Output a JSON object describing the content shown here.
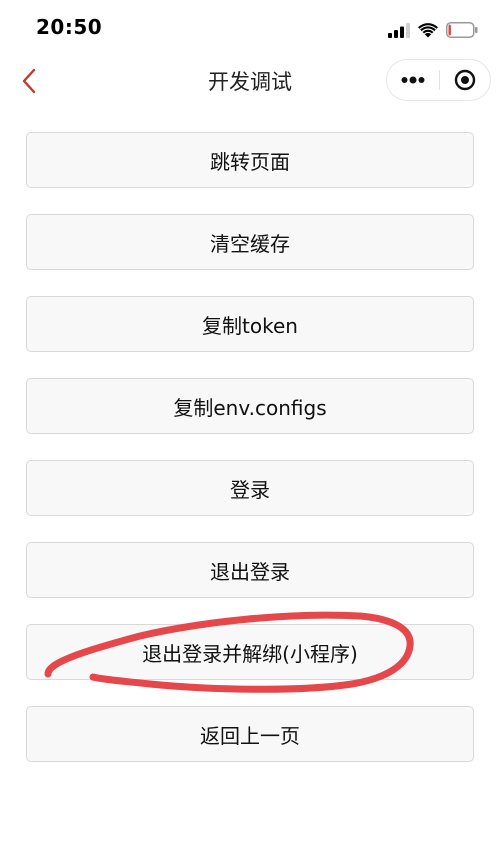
{
  "status_bar": {
    "time": "20:50",
    "icons": [
      "signal-icon",
      "wifi-icon",
      "battery-icon"
    ],
    "battery_level": 0.1,
    "battery_color": "#e0413c"
  },
  "nav": {
    "title": "开发调试",
    "back_icon": "chevron-left-icon",
    "back_color": "#c0392b",
    "more_icon": "more-dots-icon",
    "close_icon": "target-circle-icon"
  },
  "buttons": [
    {
      "label": "跳转页面"
    },
    {
      "label": "清空缓存"
    },
    {
      "label": "复制token"
    },
    {
      "label": "复制env.configs"
    },
    {
      "label": "登录"
    },
    {
      "label": "退出登录"
    },
    {
      "label": "退出登录并解绑(小程序)"
    },
    {
      "label": "返回上一页"
    }
  ],
  "annotation": {
    "type": "hand-drawn-circle",
    "target": "退出登录并解绑(小程序)",
    "color": "#e5474b"
  }
}
